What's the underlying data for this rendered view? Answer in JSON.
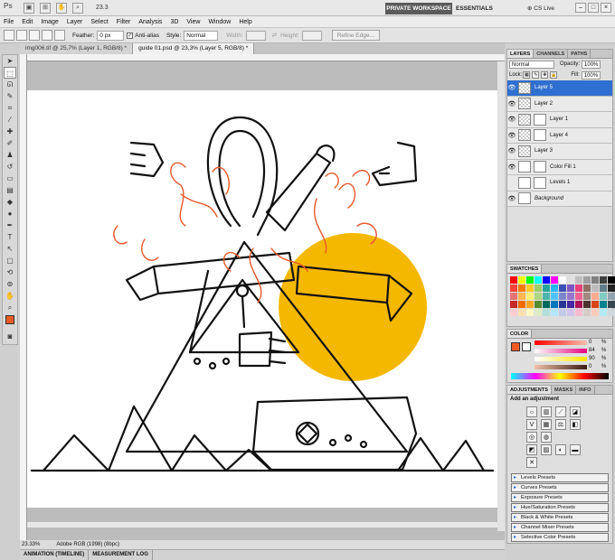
{
  "app": {
    "zoom_menu": "23.3",
    "workspace_private": "PRIVATE WORKSPACE",
    "workspace_essentials": "ESSENTIALS",
    "cs_live": "CS Live"
  },
  "menu": [
    "File",
    "Edit",
    "Image",
    "Layer",
    "Select",
    "Filter",
    "Analysis",
    "3D",
    "View",
    "Window",
    "Help"
  ],
  "options": {
    "feather_label": "Feather:",
    "feather_value": "0 px",
    "antialias_label": "Anti-alias",
    "style_label": "Style:",
    "style_value": "Normal",
    "width_label": "Width:",
    "height_label": "Height:",
    "refine_edge": "Refine Edge..."
  },
  "doc_tabs": [
    "img006.tif @ 25,7% (Layer 1, RGB/8) *",
    "guide 01.psd @ 23,3% (Layer 5, RGB/8) *"
  ],
  "status": {
    "zoom": "23.33%",
    "profile": "Adobe RGB (1998) (8bpc)"
  },
  "bottom_tabs": [
    "ANIMATION (TIMELINE)",
    "MEASUREMENT LOG"
  ],
  "layers_panel": {
    "tabs": [
      "LAYERS",
      "CHANNELS",
      "PATHS"
    ],
    "blend_mode": "Normal",
    "opacity_label": "Opacity:",
    "opacity_value": "100%",
    "lock_label": "Lock:",
    "fill_label": "Fill:",
    "fill_value": "100%",
    "layers": [
      {
        "name": "Layer 5",
        "selected": true
      },
      {
        "name": "Layer 2"
      },
      {
        "name": "Layer 1"
      },
      {
        "name": "Layer 4"
      },
      {
        "name": "Layer 3"
      },
      {
        "name": "Color Fill 1"
      },
      {
        "name": "Levels 1"
      },
      {
        "name": "Background"
      }
    ]
  },
  "swatches_panel": {
    "tab": "SWATCHES",
    "colors": [
      "#ff0000",
      "#ffff00",
      "#00ff00",
      "#00ffff",
      "#0000ff",
      "#ff00ff",
      "#ffffff",
      "#e0e0e0",
      "#c0c0c0",
      "#a0a0a0",
      "#808080",
      "#404040",
      "#000000",
      "#f44336",
      "#f57c00",
      "#ffca28",
      "#9ccc65",
      "#26a69a",
      "#29b6f6",
      "#3f51b5",
      "#7e57c2",
      "#ec407a",
      "#8d6e63",
      "#bdbdbd",
      "#607d8b",
      "#212121",
      "#e57373",
      "#ffb74d",
      "#fff176",
      "#aed581",
      "#4db6ac",
      "#4fc3f7",
      "#7986cb",
      "#9575cd",
      "#f06292",
      "#a1887f",
      "#ffab91",
      "#80cbc4",
      "#90a4ae",
      "#c62828",
      "#ef6c00",
      "#f9a825",
      "#558b2f",
      "#00695c",
      "#0277bd",
      "#283593",
      "#4527a0",
      "#ad1457",
      "#4e342e",
      "#d84315",
      "#00838f",
      "#37474f",
      "#ffcdd2",
      "#ffe0b2",
      "#fff9c4",
      "#dcedc8",
      "#b2dfdb",
      "#b3e5fc",
      "#c5cae9",
      "#d1c4e9",
      "#f8bbd0",
      "#d7ccc8",
      "#ffccbc",
      "#b2ebf2",
      "#cfd8dc"
    ]
  },
  "color_panel": {
    "tab": "COLOR",
    "channels": [
      {
        "label": "",
        "value": "0",
        "unit": "%"
      },
      {
        "label": "",
        "value": "84",
        "unit": "%"
      },
      {
        "label": "",
        "value": "90",
        "unit": "%"
      },
      {
        "label": "",
        "value": "0",
        "unit": "%"
      }
    ]
  },
  "adjustments_panel": {
    "tabs": [
      "ADJUSTMENTS",
      "MASKS",
      "INFO"
    ],
    "heading": "Add an adjustment",
    "presets": [
      "Levels Presets",
      "Curves Presets",
      "Exposure Presets",
      "Hue/Saturation Presets",
      "Black & White Presets",
      "Channel Mixer Presets",
      "Selective Color Presets"
    ]
  }
}
